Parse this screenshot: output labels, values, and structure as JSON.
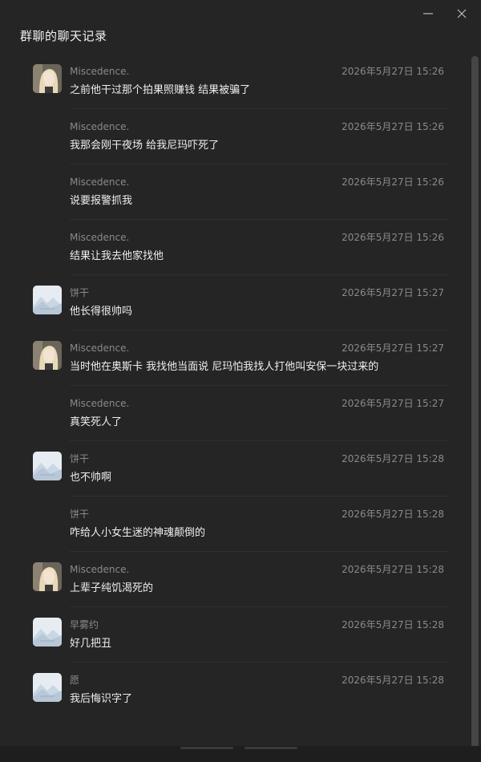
{
  "window": {
    "title": "群聊的聊天记录",
    "minimize_icon": "minimize-icon",
    "close_icon": "close-icon"
  },
  "messages": [
    {
      "sender": "Miscedence.",
      "time": "2026年5月27日 15:26",
      "text": "之前他干过那个拍果照赚钱 结果被骗了",
      "avatar": "photo"
    },
    {
      "sender": "Miscedence.",
      "time": "2026年5月27日 15:26",
      "text": "我那会刚干夜场  给我尼玛吓死了",
      "avatar": "none"
    },
    {
      "sender": "Miscedence.",
      "time": "2026年5月27日 15:26",
      "text": "说要报警抓我",
      "avatar": "none"
    },
    {
      "sender": "Miscedence.",
      "time": "2026年5月27日 15:26",
      "text": "结果让我去他家找他",
      "avatar": "none"
    },
    {
      "sender": "饼干",
      "time": "2026年5月27日 15:27",
      "text": "他长得很帅吗",
      "avatar": "placeholder"
    },
    {
      "sender": "Miscedence.",
      "time": "2026年5月27日 15:27",
      "text": "当时他在奥斯卡  我找他当面说  尼玛怕我找人打他叫安保一块过来的",
      "avatar": "photo"
    },
    {
      "sender": "Miscedence.",
      "time": "2026年5月27日 15:27",
      "text": "真笑死人了",
      "avatar": "none"
    },
    {
      "sender": "饼干",
      "time": "2026年5月27日 15:28",
      "text": "也不帅啊",
      "avatar": "placeholder"
    },
    {
      "sender": "饼干",
      "time": "2026年5月27日 15:28",
      "text": "咋给人小女生迷的神魂颠倒的",
      "avatar": "none"
    },
    {
      "sender": "Miscedence.",
      "time": "2026年5月27日 15:28",
      "text": "上辈子纯饥渴死的",
      "avatar": "photo"
    },
    {
      "sender": "早雾约",
      "time": "2026年5月27日 15:28",
      "text": "好几把丑",
      "avatar": "placeholder"
    },
    {
      "sender": "愿",
      "time": "2026年5月27日 15:28",
      "text": "我后悔识字了",
      "avatar": "placeholder"
    }
  ],
  "colors": {
    "background": "#252525",
    "text": "#eeeeee",
    "meta_text": "#8a8a8a",
    "divider": "#2f2f2f"
  }
}
